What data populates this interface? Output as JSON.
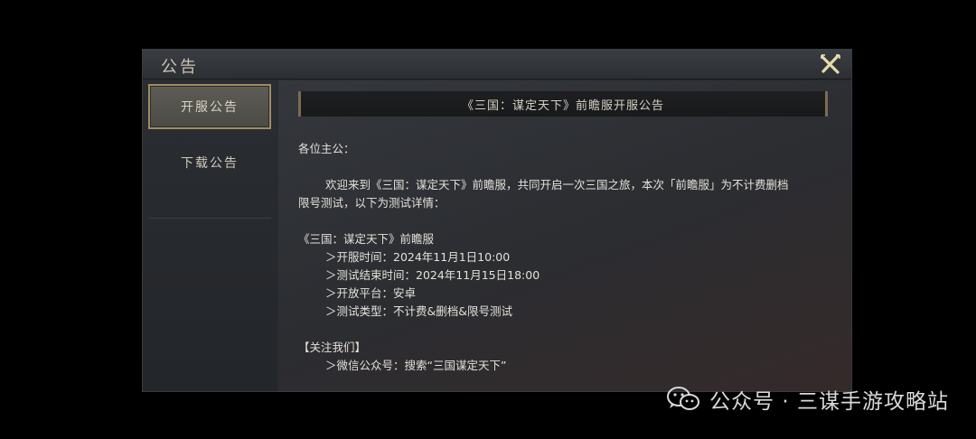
{
  "dialog": {
    "title": "公告",
    "close_icon": "close-x-icon"
  },
  "tabs": [
    {
      "label": "开服公告",
      "active": true
    },
    {
      "label": "下载公告",
      "active": false
    }
  ],
  "announcement": {
    "banner": "《三国：谋定天下》前瞻服开服公告",
    "greeting": "各位主公：",
    "intro_line1": "欢迎来到《三国：谋定天下》前瞻服，共同开启一次三国之旅，本次「前瞻服」为不计费删档",
    "intro_line2": "限号测试，以下为测试详情：",
    "server_name": "《三国：谋定天下》前瞻服",
    "details": [
      "＞开服时间：2024年11月1日10:00",
      "＞测试结束时间：2024年11月15日18:00",
      "＞开放平台：安卓",
      "＞测试类型：不计费&删档&限号测试"
    ],
    "follow_header": "【关注我们】",
    "follow_items": [
      "＞微信公众号：搜索“三国谋定天下”"
    ]
  },
  "watermark": {
    "text": "公众号 · 三谋手游攻略站",
    "icon": "wechat-icon"
  },
  "colors": {
    "accent_gold": "#9d8d63",
    "text_light": "#e4e1da"
  }
}
